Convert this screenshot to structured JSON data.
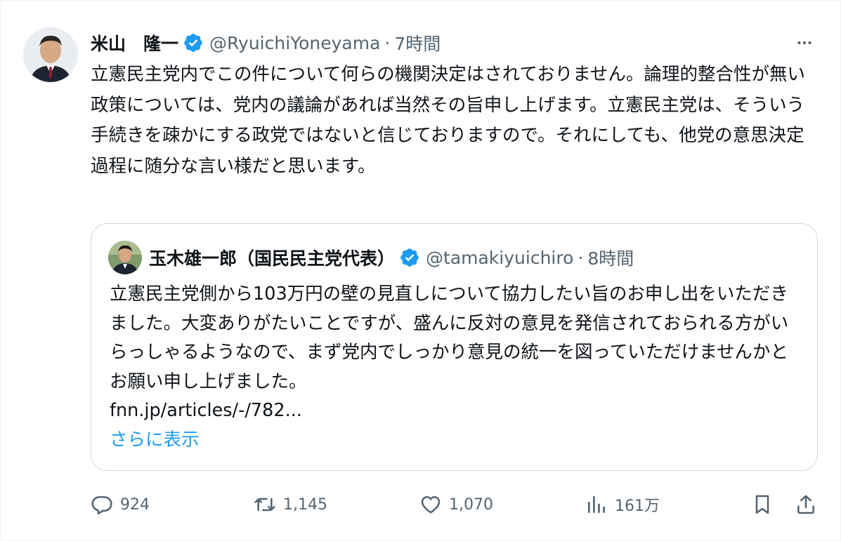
{
  "author": {
    "display_name": "米山　隆一",
    "handle": "@RyuichiYoneyama",
    "separator": "·",
    "time": "7時間"
  },
  "tweet": {
    "text": "立憲民主党内でこの件について何らの機関決定はされておりません。論理的整合性が無い政策については、党内の議論があれば当然その旨申し上げます。立憲民主党は、そういう手続きを疎かにする政党ではないと信じておりますので。それにしても、他党の意思決定過程に随分な言い様だと思います。"
  },
  "quote": {
    "display_name": "玉木雄一郎（国民民主党代表）",
    "handle": "@tamakiyuichiro",
    "separator": "·",
    "time": "8時間",
    "text": "立憲民主党側から103万円の壁の見直しについて協力したい旨のお申し出をいただきました。大変ありがたいことですが、盛んに反対の意見を発信されておられる方がいらっしゃるようなので、まず党内でしっかり意見の統一を図っていただけませんかとお願い申し上げました。",
    "link": "fnn.jp/articles/-/782...",
    "show_more": "さらに表示"
  },
  "actions": {
    "replies": "924",
    "reposts": "1,145",
    "likes": "1,070",
    "views": "161万"
  },
  "icons": {
    "verified": "verified-badge-icon",
    "more": "more-horizontal-icon",
    "reply": "reply-icon",
    "repost": "repost-icon",
    "like": "heart-icon",
    "views": "views-chart-icon",
    "bookmark": "bookmark-icon",
    "share": "share-icon"
  },
  "colors": {
    "accent": "#1d9bf0",
    "text": "#0f1419",
    "muted": "#536471",
    "border": "#cfd9de"
  }
}
